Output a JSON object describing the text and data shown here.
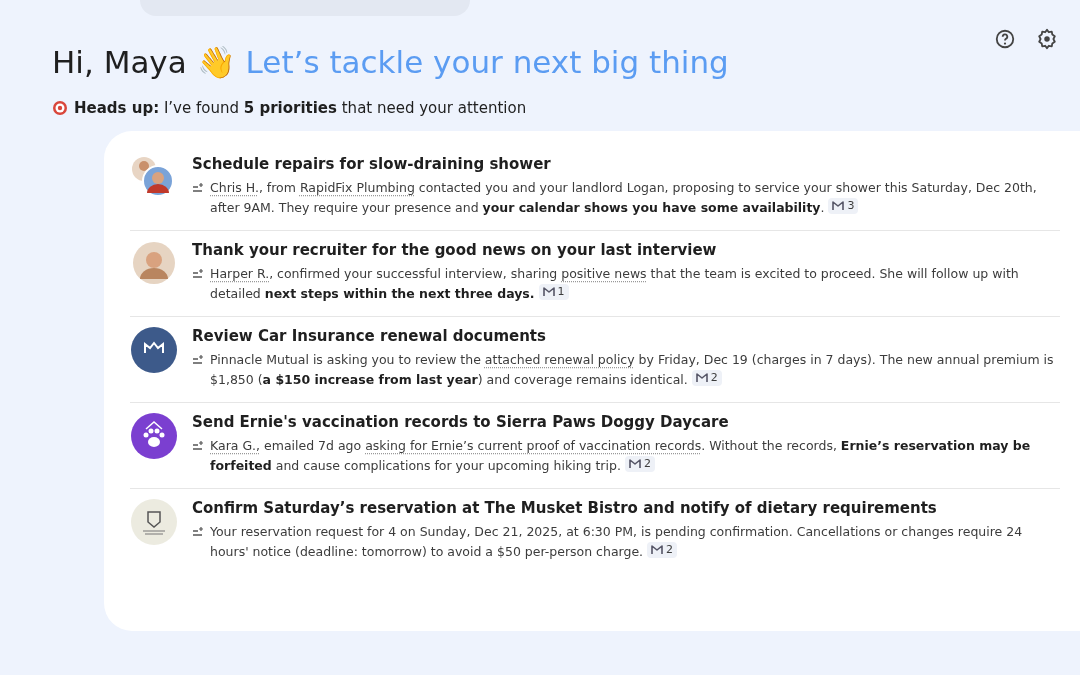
{
  "header": {
    "greeting": "Hi, Maya 👋",
    "tagline": "Let’s tackle your next big thing",
    "notice": "**Heads up:** I’ve found **5 priorities** that need your attention"
  },
  "priorities": [
    {
      "kind": "people",
      "title": "Schedule repairs for slow-draining shower",
      "summary": [
        {
          "kind": "link",
          "text": "Chris H."
        },
        {
          "kind": "text",
          "text": ", from "
        },
        {
          "kind": "link",
          "text": "RapidFix Plumbing"
        },
        {
          "kind": "text",
          "text": " contacted you and your landlord Logan, proposing to service your shower this Saturday, Dec 20th, after 9AM. They require your presence and **your calendar shows you have some availability**."
        }
      ],
      "emails": "3"
    },
    {
      "kind": "person",
      "title": "Thank your recruiter for the good news on your last interview",
      "summary": [
        {
          "kind": "link",
          "text": "Harper R."
        },
        {
          "kind": "text",
          "text": ", confirmed your successful interview, sharing "
        },
        {
          "kind": "link",
          "text": "positive news"
        },
        {
          "kind": "text",
          "text": " that the team is excited to proceed. She will follow up with detailed **next steps within the next three days.**"
        }
      ],
      "emails": "1"
    },
    {
      "kind": "insurer",
      "title": "Review Car Insurance renewal documents",
      "summary": [
        {
          "kind": "text",
          "text": "Pinnacle Mutual is asking you to review the "
        },
        {
          "kind": "link",
          "text": "attached renewal policy"
        },
        {
          "kind": "text",
          "text": " by Friday, Dec 19 (charges in 7 days). The new annual premium is $1,850 (**a $150 increase from last year**) and coverage remains identical."
        }
      ],
      "emails": "2"
    },
    {
      "kind": "daycare",
      "title": "Send Ernie's vaccination records to Sierra Paws Doggy Daycare",
      "summary": [
        {
          "kind": "link",
          "text": "Kara G.,"
        },
        {
          "kind": "text",
          "text": " emailed 7d ago "
        },
        {
          "kind": "link",
          "text": "asking for Ernie’s current proof of vaccination records"
        },
        {
          "kind": "text",
          "text": ". Without the records, **Ernie’s reservation may be forfeited** and cause complications for your upcoming hiking trip."
        }
      ],
      "emails": "2"
    },
    {
      "kind": "bistro",
      "title": "Confirm Saturday’s reservation at The Musket Bistro and notify of dietary requirements",
      "summary": [
        {
          "kind": "text",
          "text": "Your reservation request for 4 on Sunday, Dec 21, 2025, at 6:30 PM, is pending confirmation. Cancellations or changes require 24 hours' notice (deadline: tomorrow) to avoid a $50 per-person charge."
        }
      ],
      "emails": "2"
    }
  ]
}
